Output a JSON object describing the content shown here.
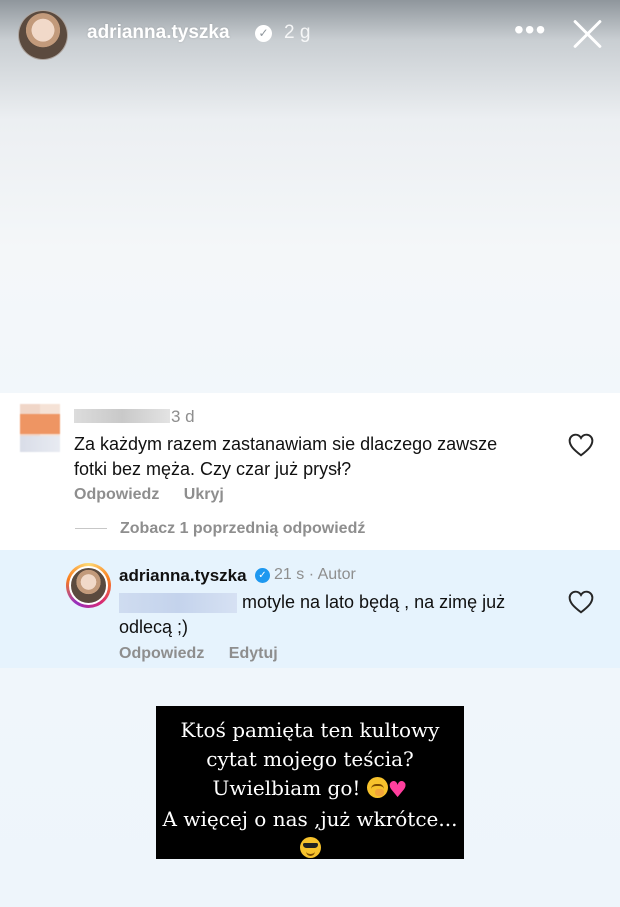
{
  "header": {
    "username": "adrianna.tyszka",
    "time": "2 g",
    "more_icon": "more-horizontal-icon",
    "close_icon": "close-icon"
  },
  "comment": {
    "time": "3 d",
    "text": "Za każdym razem zastanawiam sie dlaczego zawsze fotki bez męża. Czy czar już prysł?",
    "actions": [
      "Odpowiedz",
      "Ukryj"
    ],
    "view_previous": "Zobacz 1 poprzednią odpowiedź"
  },
  "reply": {
    "username": "adrianna.tyszka",
    "meta": "21 s · Autor",
    "text": "motyle na lato będą , na zimę już odlecą ;)",
    "actions": [
      "Odpowiedz",
      "Edytuj"
    ]
  },
  "caption": {
    "line1": "Ktoś pamięta ten kultowy",
    "line2": "cytat mojego teścia?",
    "line3": "Uwielbiam go!",
    "line4": "A więcej o nas ,już wkrótce..."
  },
  "colors": {
    "reply_bg": "#e6f3fd",
    "verified": "#1e98f0",
    "muted": "#8e8e8e"
  }
}
